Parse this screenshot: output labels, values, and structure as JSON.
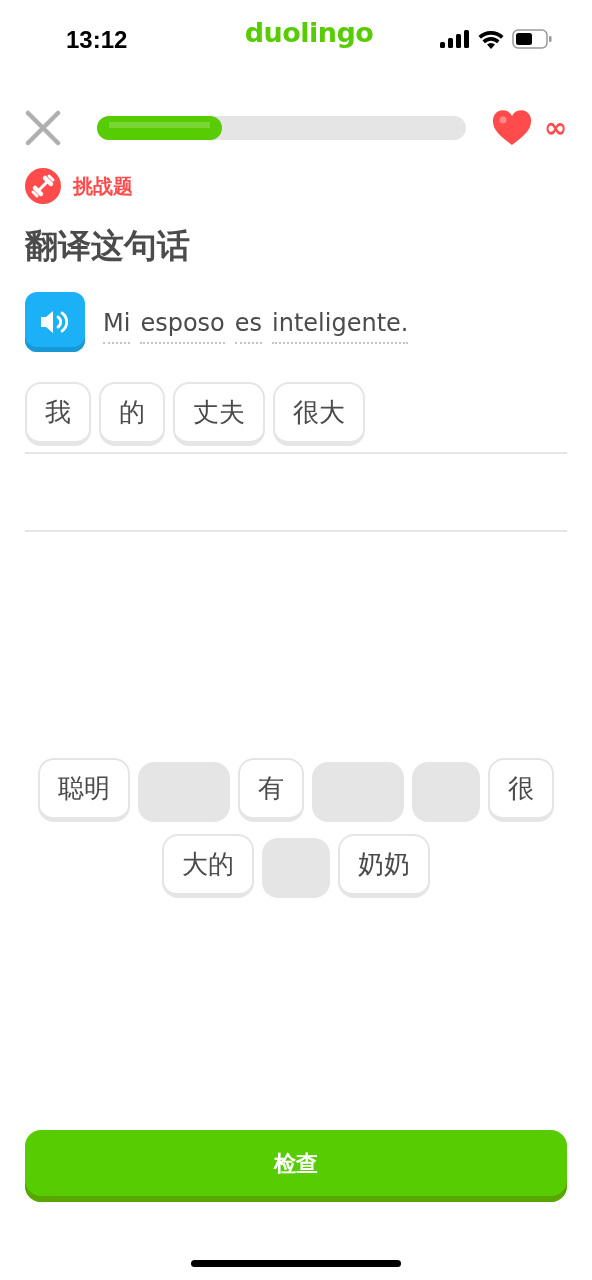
{
  "status_bar": {
    "time": "13:12",
    "logo": "duolingo"
  },
  "header": {
    "progress": {
      "level": 0.34
    },
    "lives": "∞"
  },
  "badge": {
    "label": "挑战题"
  },
  "title": "翻译这句话",
  "prompt": {
    "words": [
      "Mi",
      "esposo",
      "es",
      "inteligente."
    ]
  },
  "answer": [
    {
      "text": "我"
    },
    {
      "text": "的"
    },
    {
      "text": "丈夫"
    },
    {
      "text": "很大"
    }
  ],
  "word_bank": [
    {
      "kind": "word",
      "text": "聪明"
    },
    {
      "kind": "wideslot"
    },
    {
      "kind": "word",
      "text": "有"
    },
    {
      "kind": "wideslot"
    },
    {
      "kind": "slot"
    },
    {
      "kind": "word",
      "text": "很"
    },
    {
      "kind": "word",
      "text": "大的"
    },
    {
      "kind": "slot"
    },
    {
      "kind": "word",
      "text": "奶奶"
    }
  ],
  "check_button": {
    "label": "检查"
  }
}
